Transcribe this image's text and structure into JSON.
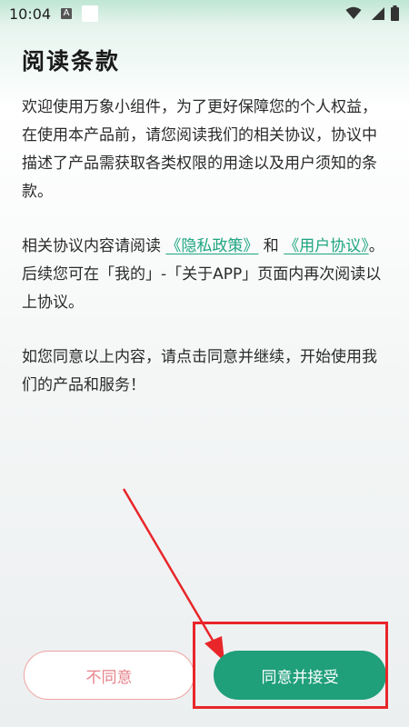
{
  "status_bar": {
    "time": "10:04",
    "a_icon_letter": "A",
    "icons": [
      "wifi-icon",
      "signal-icon",
      "battery-icon"
    ]
  },
  "title": "阅读条款",
  "paragraphs": {
    "p1": "欢迎使用万象小组件，为了更好保障您的个人权益，在使用本产品前，请您阅读我们的相关协议，协议中描述了产品需获取各类权限的用途以及用户须知的条款。",
    "p2_prefix": "相关协议内容请阅读 ",
    "privacy_link": "《隐私政策》",
    "p2_and": " 和 ",
    "user_agreement_link": "《用户协议》",
    "p2_suffix": "。后续您可在「我的」-「关于APP」页面内再次阅读以上协议。",
    "p3": "如您同意以上内容，请点击同意并继续，开始使用我们的产品和服务！"
  },
  "buttons": {
    "disagree": "不同意",
    "agree": "同意并接受"
  },
  "colors": {
    "accent": "#1f9f7a",
    "link": "#1ea580",
    "disagree_border": "#f0a3a3",
    "disagree_text": "#e7838a",
    "annotation": "#e8262a"
  }
}
